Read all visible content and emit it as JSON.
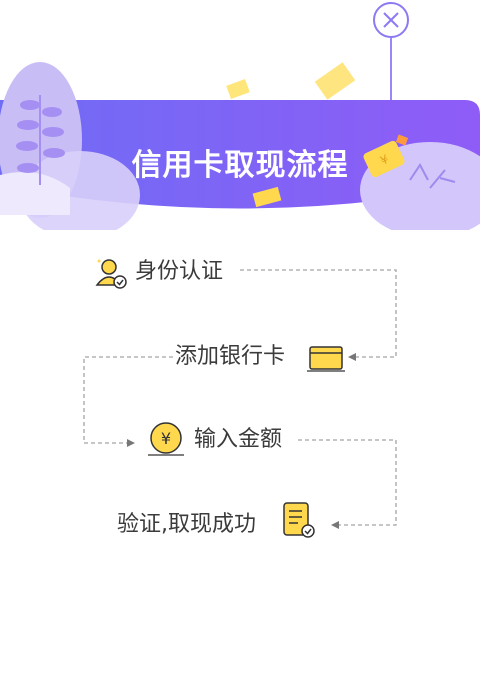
{
  "header": {
    "title": "信用卡取现流程",
    "close_icon": "close-icon",
    "accent_color": "#7e62f6",
    "coin_color": "#ffd84d"
  },
  "steps": [
    {
      "label": "身份认证",
      "icon": "user-verified-icon"
    },
    {
      "label": "添加银行卡",
      "icon": "bank-card-icon"
    },
    {
      "label": "输入金额",
      "icon": "yen-coin-icon"
    },
    {
      "label": "验证,取现成功",
      "icon": "receipt-check-icon"
    }
  ]
}
